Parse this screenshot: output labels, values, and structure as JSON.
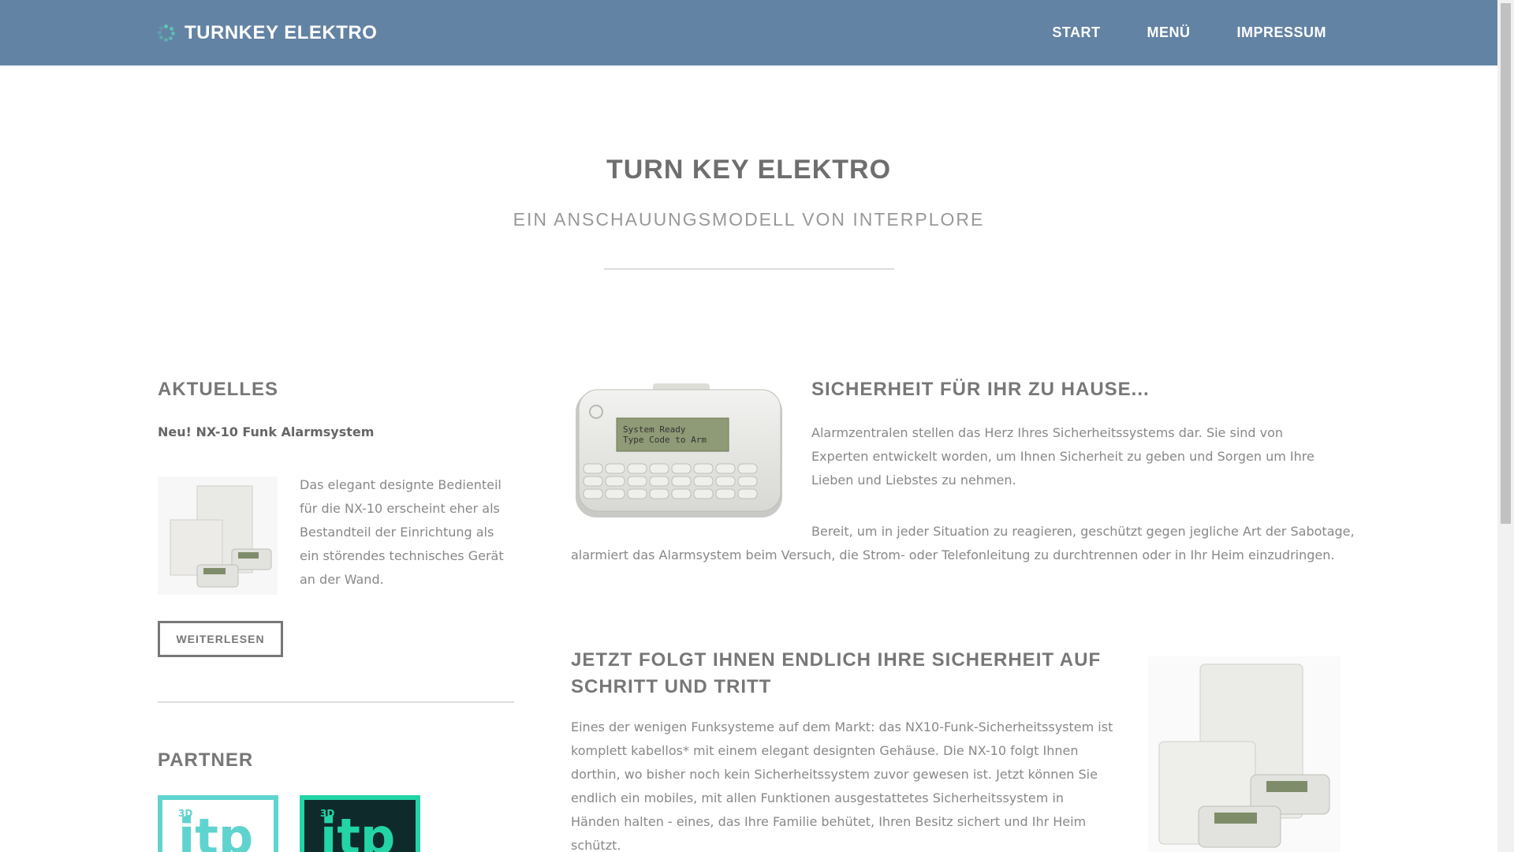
{
  "navbar": {
    "brand": "TURNKEY ELEKTRO",
    "items": [
      "START",
      "MENÜ",
      "IMPRESSUM"
    ]
  },
  "hero": {
    "title": "TURN KEY ELEKTRO",
    "subtitle": "EIN ANSCHAUUNGSMODELL VON INTERPLORE"
  },
  "aktuelles": {
    "heading": "AKTUELLES",
    "news_title": "Neu! NX-10 Funk Alarmsystem",
    "news_text": "Das elegant designte Bedienteil für die NX-10 erscheint eher als Bestandteil der Einrichtung als ein störendes technisches Gerät an der Wand.",
    "button": "WEITERLESEN"
  },
  "partner": {
    "heading": "PARTNER",
    "logo1_text": "itp",
    "logo2_text": "itp",
    "logo_badge": "3D"
  },
  "section1": {
    "heading": "SICHERHEIT FÜR IHR ZU HAUSE...",
    "para1": "Alarmzentralen stellen das Herz Ihres Sicherheitssystems dar. Sie sind von Experten entwickelt worden, um Ihnen Sicherheit zu geben und Sorgen um Ihre Lieben und Liebstes zu nehmen.",
    "para2_line1": "Bereit, um in jeder Situation zu reagieren, geschützt gegen jegliche Art der Sabotage,",
    "para2_line2": "alarmiert das Alarmsystem beim Versuch, die Strom- oder Telefonleitung zu durchtrennen oder in Ihr Heim einzudringen.",
    "keypad_lcd_line1": "System Ready",
    "keypad_lcd_line2": "Type Code to Arm"
  },
  "section2": {
    "heading_line1": "JETZT FOLGT IHNEN ENDLICH IHRE SICHERHEIT AUF",
    "heading_line2": "SCHRITT UND TRITT",
    "para": "Eines der wenigen Funksysteme auf dem Markt: das NX10-Funk-Sicherheitssystem ist komplett kabellos* mit einem elegant designten Gehäuse. Die NX-10 folgt Ihnen dorthin, wo bisher noch kein Sicherheitssystem zuvor gewesen ist. Jetzt können Sie endlich ein mobiles, mit allen Funktionen ausgestattetes Sicherheitssystem in Händen halten - eines, das Ihre Familie behütet, Ihren Besitz sichert und Ihr Heim schützt."
  },
  "colors": {
    "navbar": "#6383a4",
    "accent_teal": "#5fc7b5",
    "text": "#888888",
    "heading": "#777777"
  }
}
